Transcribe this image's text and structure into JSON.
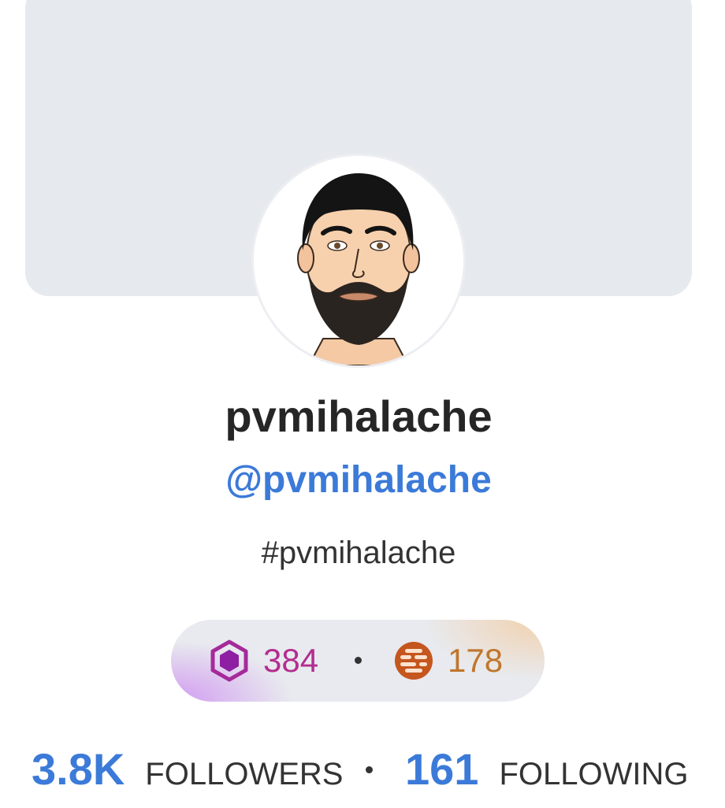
{
  "profile": {
    "display_name": "pvmihalache",
    "handle": "@pvmihalache",
    "hashtag": "#pvmihalache"
  },
  "balances": {
    "gems": "384",
    "coins": "178",
    "gem_icon": "hexagon-gem-icon",
    "coin_icon": "striped-coin-icon",
    "gem_color": "#b42d8f",
    "coin_color": "#c0762c"
  },
  "stats": {
    "followers_count": "3.8K",
    "followers_label": "FOLLOWERS",
    "following_count": "161",
    "following_label": "FOLLOWING"
  },
  "colors": {
    "accent": "#3b7ad8",
    "cover": "#e6e9ee"
  }
}
